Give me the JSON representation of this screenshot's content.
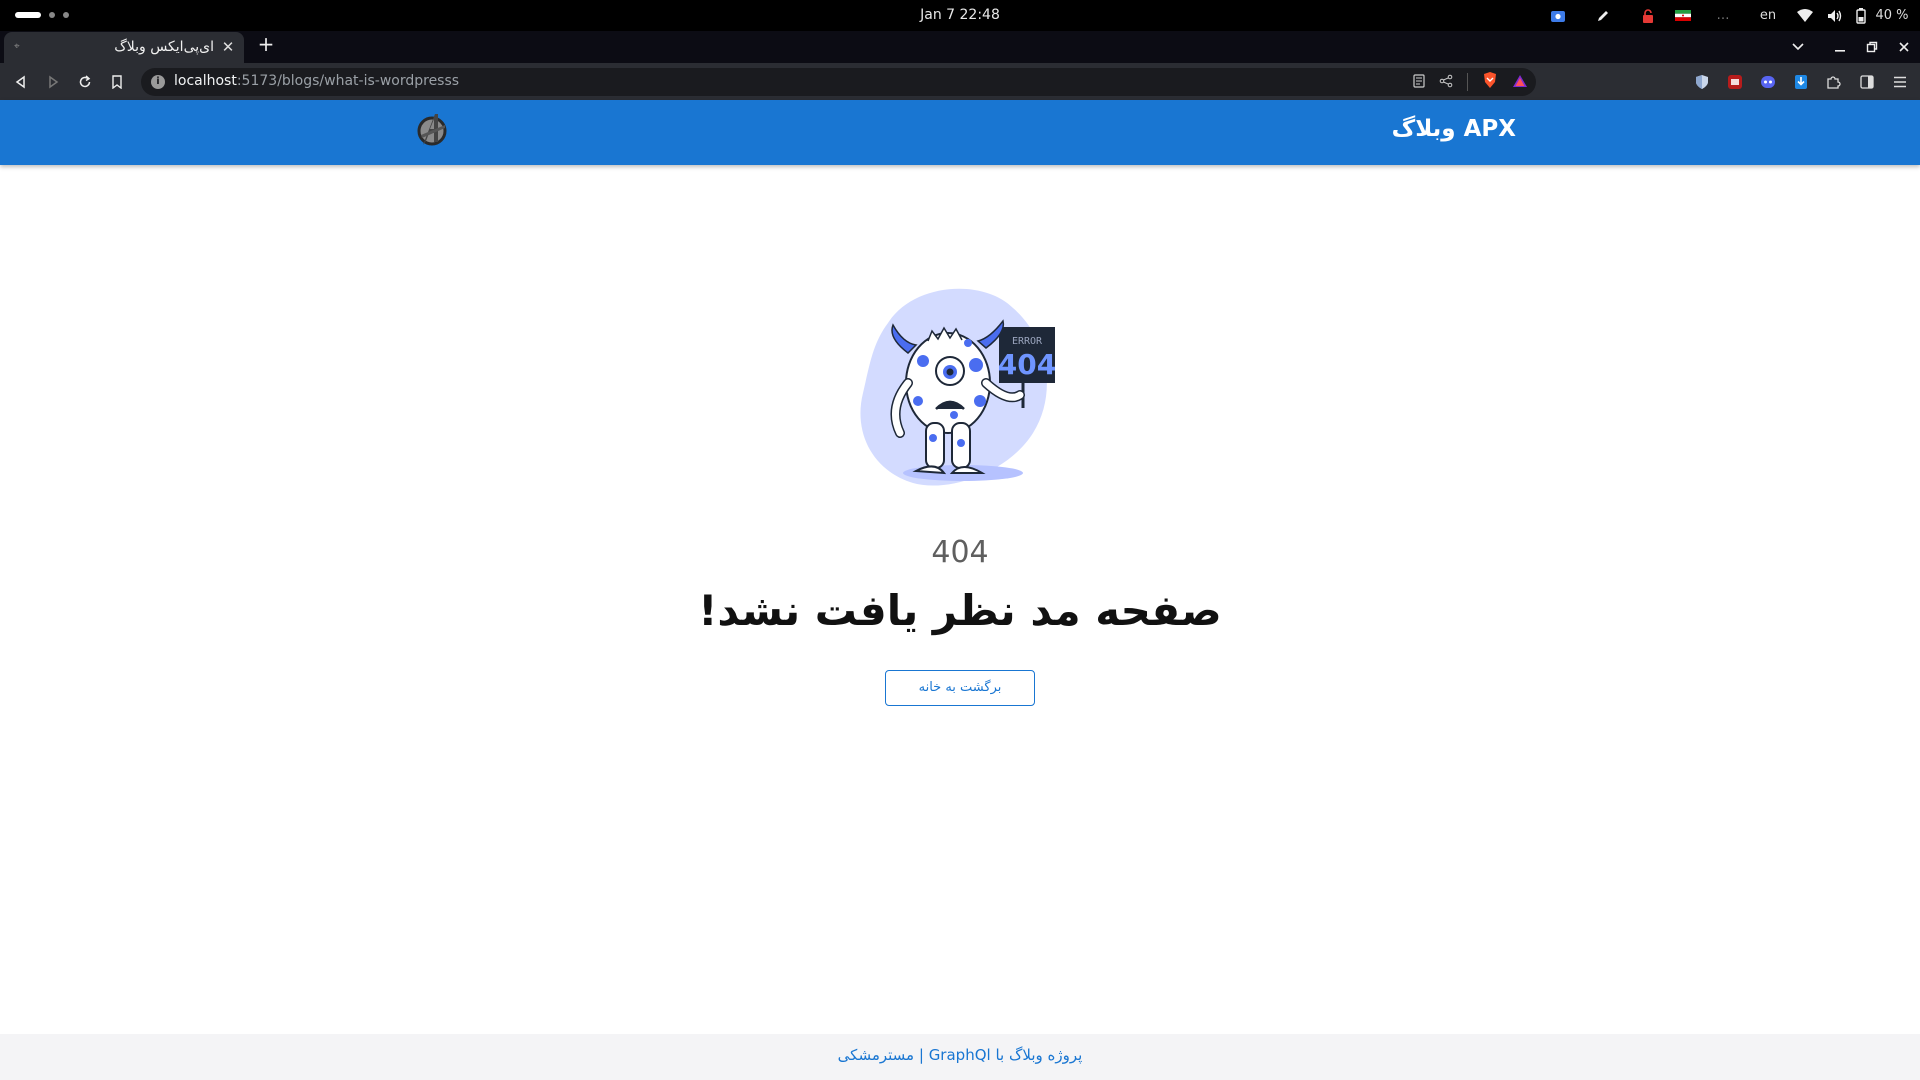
{
  "os": {
    "clock": "Jan 7  22:48",
    "keyboard_layout": "en",
    "battery": "40 %",
    "tray_icons": [
      "screencast-icon",
      "pen-icon",
      "lock-icon",
      "flag-iran-icon",
      "ellipsis-icon",
      "wifi-icon",
      "volume-icon",
      "battery-icon"
    ]
  },
  "browser": {
    "tab": {
      "title": "ای‌پی‌ایکس وبلاگ"
    },
    "url": {
      "host": "localhost",
      "rest": ":5173/blogs/what-is-wordpresss"
    },
    "extensions": [
      "shield-ext-icon",
      "ublock-ext-icon",
      "discord-ext-icon",
      "download-ext-icon",
      "puzzle-ext-icon",
      "sidebar-icon",
      "menu-icon"
    ]
  },
  "header": {
    "title": "APX وبلاگ",
    "brand_color": "#1976d2"
  },
  "error": {
    "illustration_sign_small": "ERROR",
    "illustration_sign_big": "404",
    "code": "404",
    "message": "صفحه مد نظر یافت نشد!",
    "home_button": "برگشت به خانه"
  },
  "footer": {
    "text": "پروژه وبلاگ با GraphQl | مسترمشکی"
  }
}
